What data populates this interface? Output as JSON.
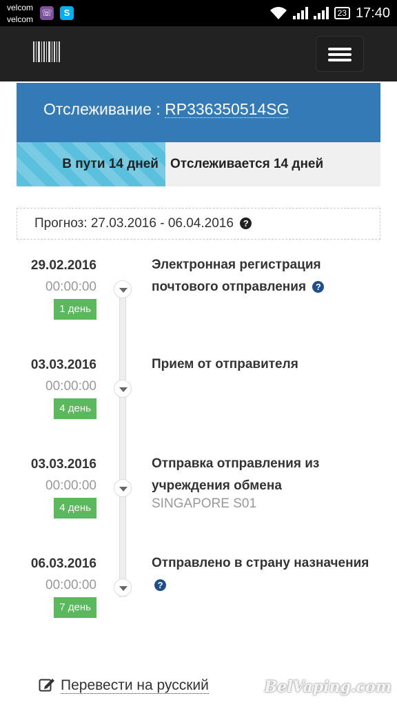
{
  "status_bar": {
    "carrier_1": "velcom",
    "carrier_2": "velcom",
    "battery": "23",
    "time": "17:40"
  },
  "navbar": {
    "logo_icon": "barcode-icon",
    "menu_icon": "hamburger-icon"
  },
  "tracking": {
    "label": "Отслеживание : ",
    "number": "RP336350514SG"
  },
  "progress": {
    "in_transit": "В пути 14 дней",
    "tracked": "Отслеживается 14 дней",
    "fraction": 0.41
  },
  "forecast": {
    "text": "Прогноз: 27.03.2016 - 06.04.2016"
  },
  "events": [
    {
      "date": "29.02.2016",
      "time": "00:00:00",
      "badge": "1 день",
      "title": "Электронная регистрация почтового отправления",
      "location": ""
    },
    {
      "date": "03.03.2016",
      "time": "00:00:00",
      "badge": "4 день",
      "title": "Прием от отправителя",
      "location": ""
    },
    {
      "date": "03.03.2016",
      "time": "00:00:00",
      "badge": "4 день",
      "title": "Отправка отправления из учреждения обмена",
      "location": "SINGAPORE S01"
    },
    {
      "date": "06.03.2016",
      "time": "00:00:00",
      "badge": "7 день",
      "title": "Отправлено в страну назначения",
      "location": ""
    }
  ],
  "translate": {
    "label": "Перевести на русский"
  },
  "watermark": "BelVaping.com",
  "colors": {
    "header_blue": "#337ab7",
    "progress_blue": "#5bc0de",
    "badge_green": "#5cb85c"
  }
}
